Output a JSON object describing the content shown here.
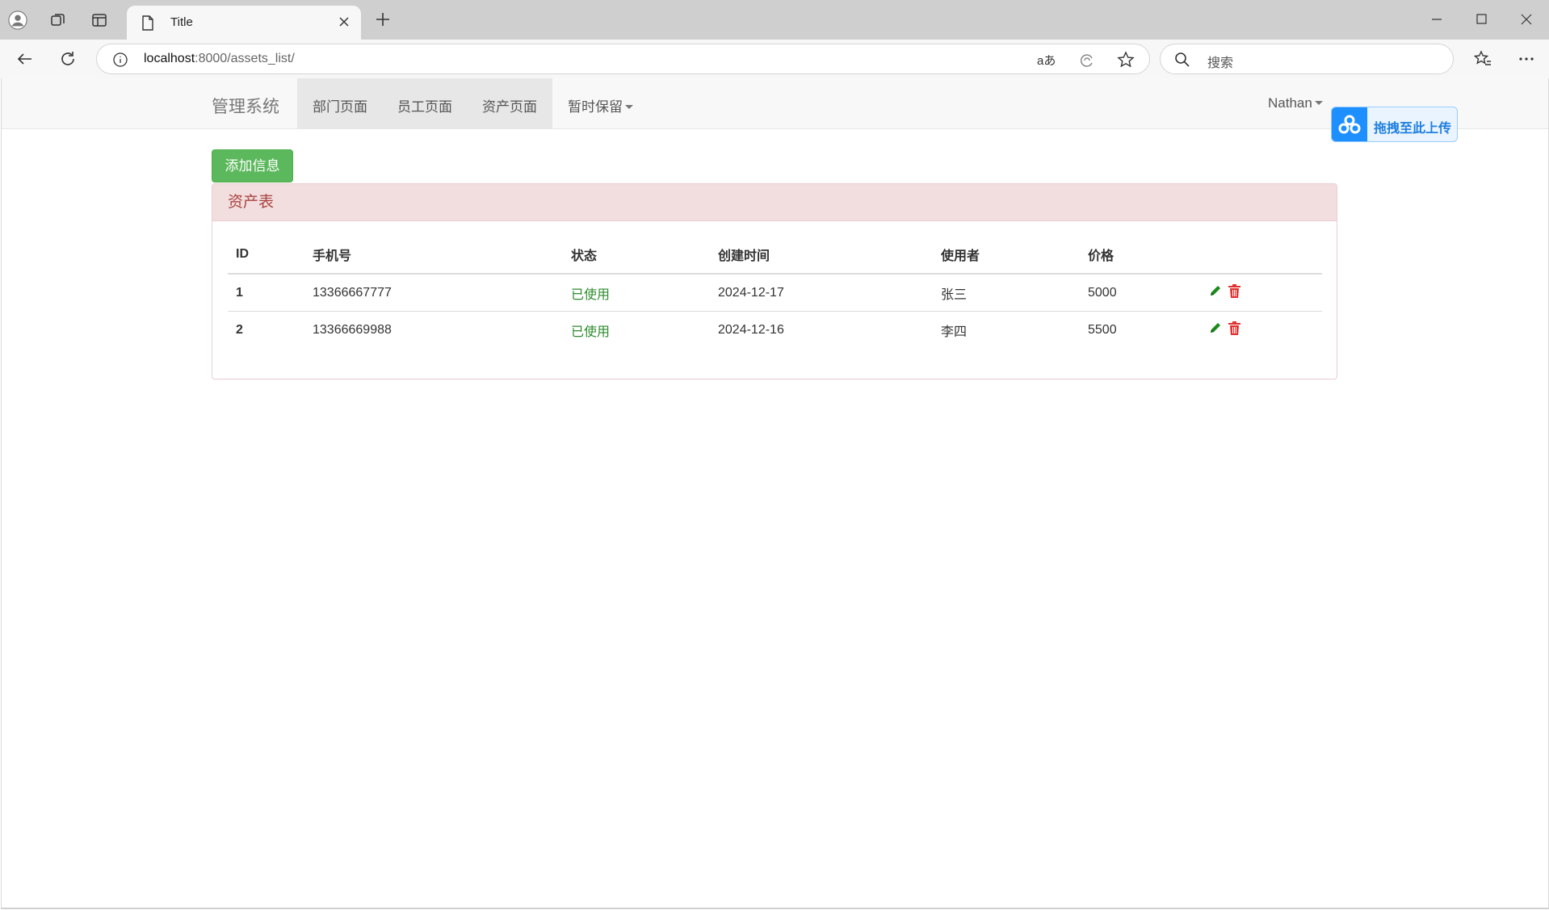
{
  "browser": {
    "tab_title": "Title",
    "url_host": "localhost",
    "url_rest": ":8000/assets_list/",
    "search_placeholder": "搜索",
    "translate_label": "aあ"
  },
  "navbar": {
    "brand": "管理系统",
    "links": [
      "部门页面",
      "员工页面",
      "资产页面",
      "暂时保留"
    ],
    "user": "Nathan"
  },
  "upload_widget": {
    "label": "拖拽至此上传"
  },
  "page": {
    "add_button": "添加信息",
    "panel_title": "资产表"
  },
  "table": {
    "headers": [
      "ID",
      "手机号",
      "状态",
      "创建时间",
      "使用者",
      "价格",
      ""
    ],
    "rows": [
      {
        "id": "1",
        "phone": "13366667777",
        "status": "已使用",
        "created": "2024-12-17",
        "user": "张三",
        "price": "5000"
      },
      {
        "id": "2",
        "phone": "13366669988",
        "status": "已使用",
        "created": "2024-12-16",
        "user": "李四",
        "price": "5500"
      }
    ]
  },
  "colors": {
    "success": "#5cb85c",
    "danger_heading_bg": "#f2dede",
    "danger_text": "#a94442",
    "status_green": "#2e8b2e",
    "edit_icon": "#1a8a1a",
    "delete_icon": "#e03030"
  }
}
